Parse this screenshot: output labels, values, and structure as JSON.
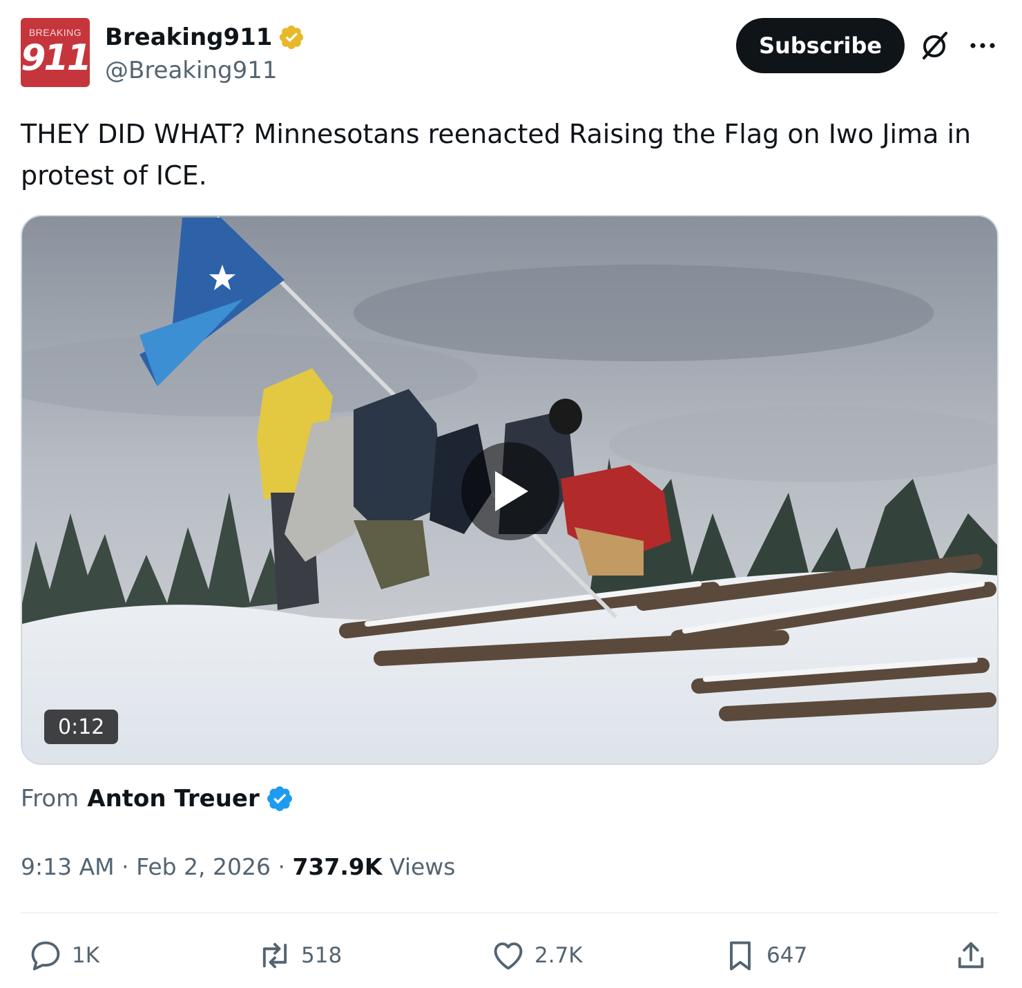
{
  "author": {
    "avatar_small_text": "BREAKING",
    "avatar_big_text": "911",
    "display_name": "Breaking911",
    "handle": "@Breaking911",
    "verified_badge": "gold-check-icon",
    "avatar_color": "#c5363c"
  },
  "header": {
    "subscribe_label": "Subscribe",
    "grok_icon": "grok-icon",
    "more_icon": "more-dots-icon"
  },
  "tweet": {
    "text": "THEY DID WHAT? Minnesotans reenacted Raising the Flag on Iwo Jima in protest of ICE."
  },
  "media": {
    "duration": "0:12",
    "play_icon": "play-icon"
  },
  "attribution": {
    "from_label": "From",
    "from_name": "Anton Treuer",
    "badge": "blue-check-icon"
  },
  "meta": {
    "time": "9:13 AM",
    "separator": " · ",
    "date": "Feb 2, 2026",
    "views_count": "737.9K",
    "views_label": "Views"
  },
  "actions": {
    "replies": "1K",
    "reposts": "518",
    "likes": "2.7K",
    "bookmarks": "647"
  },
  "colors": {
    "text_primary": "#0f1419",
    "text_secondary": "#536471",
    "verified_blue": "#1d9bf0",
    "verified_gold": "#e8b829"
  }
}
